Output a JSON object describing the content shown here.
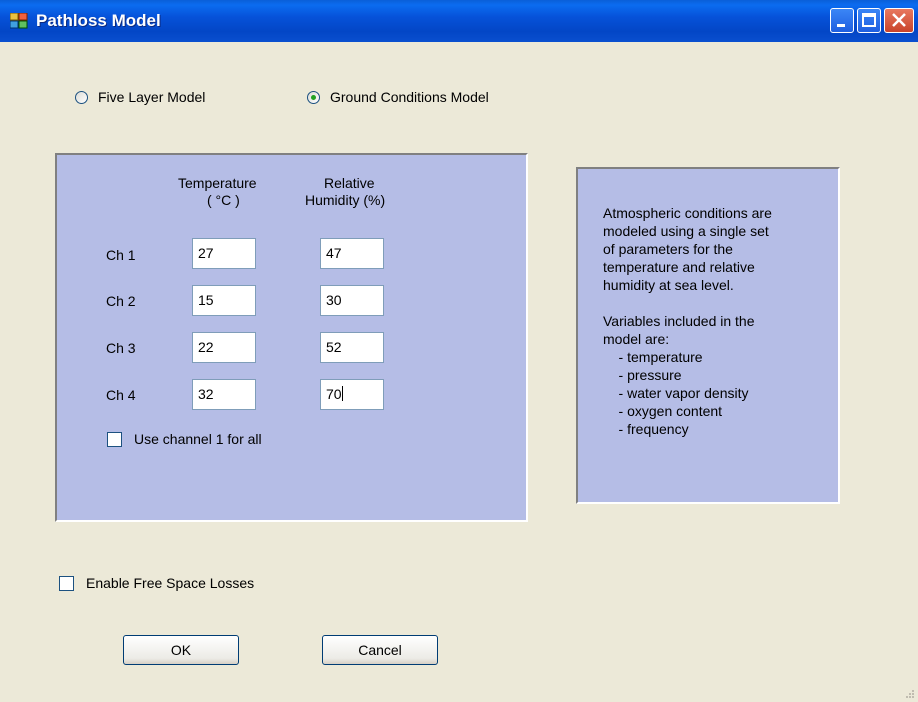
{
  "window": {
    "title": "Pathloss Model",
    "controls": [
      "minimize-icon",
      "maximize-icon",
      "close-icon"
    ]
  },
  "model_selection": {
    "options": [
      {
        "label": "Five Layer Model",
        "selected": false
      },
      {
        "label": "Ground Conditions Model",
        "selected": true
      }
    ]
  },
  "channels_panel": {
    "header_temperature_line1": "Temperature",
    "header_temperature_line2": "( °C )",
    "header_humidity_line1": "Relative",
    "header_humidity_line2": "Humidity (%)",
    "rows": [
      {
        "label": "Ch 1",
        "temperature": "27",
        "humidity": "47"
      },
      {
        "label": "Ch 2",
        "temperature": "15",
        "humidity": "30"
      },
      {
        "label": "Ch 3",
        "temperature": "22",
        "humidity": "52"
      },
      {
        "label": "Ch 4",
        "temperature": "32",
        "humidity": "70"
      }
    ],
    "use_channel1_label": "Use channel 1 for all",
    "use_channel1_checked": false
  },
  "info_panel": {
    "text": "Atmospheric conditions are\nmodeled using a single set\nof parameters for the\ntemperature and relative\nhumidity at sea level.\n\nVariables included in the\nmodel are:\n    - temperature\n    - pressure\n    - water vapor density\n    - oxygen content\n    - frequency"
  },
  "free_space": {
    "label": "Enable Free Space Losses",
    "checked": false
  },
  "buttons": {
    "ok_label": "OK",
    "cancel_label": "Cancel"
  },
  "colors": {
    "panel_background": "#b5bde6",
    "window_background": "#ece9d8",
    "titlebar": "#0346c6"
  }
}
